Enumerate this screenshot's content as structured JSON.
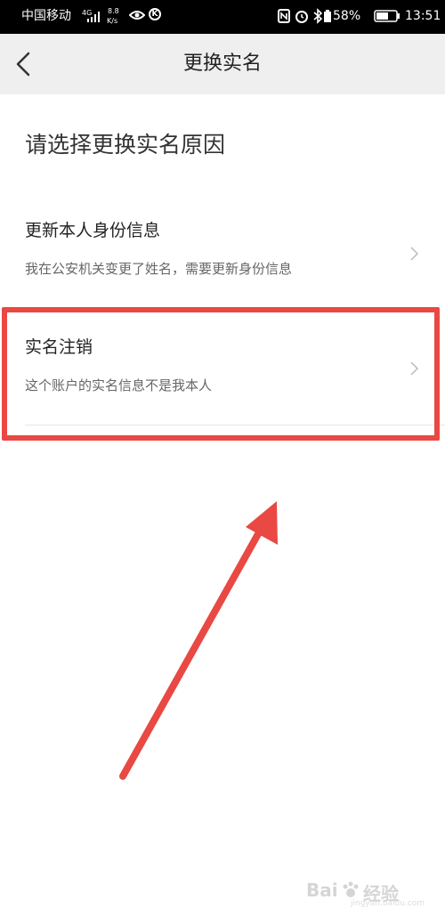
{
  "status_bar": {
    "carrier": "中国移动",
    "network": "4G",
    "speed_value": "8.8",
    "speed_unit": "K/s",
    "k_badge": "K",
    "battery_pct": "58%",
    "time": "13:51"
  },
  "nav": {
    "title": "更换实名"
  },
  "page": {
    "heading": "请选择更换实名原因"
  },
  "options": [
    {
      "title": "更新本人身份信息",
      "desc": "我在公安机关变更了姓名，需要更新身份信息"
    },
    {
      "title": "实名注销",
      "desc": "这个账户的实名信息不是我本人"
    }
  ],
  "colors": {
    "annotation": "#e94843",
    "nav_bg": "#efefef",
    "status_bg": "#000000"
  },
  "watermark": {
    "brand": "Bai",
    "brand_cn": "经验",
    "url": "jingyan.baidu.com"
  }
}
